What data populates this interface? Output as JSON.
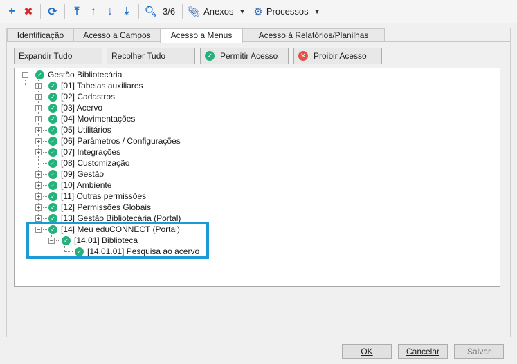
{
  "toolbar": {
    "record_position": "3/6",
    "attachments_label": "Anexos",
    "processes_label": "Processos"
  },
  "tabs": [
    {
      "label": "Identificação"
    },
    {
      "label": "Acesso a Campos"
    },
    {
      "label": "Acesso a Menus"
    },
    {
      "label": "Acesso à Relatórios/Planilhas"
    }
  ],
  "actions": {
    "expand": "Expandir Tudo",
    "collapse": "Recolher Tudo",
    "allow": "Permitir Acesso",
    "deny": "Proibir Acesso"
  },
  "tree": {
    "root": "Gestão Bibliotecária",
    "items": [
      {
        "label": "[01] Tabelas auxiliares"
      },
      {
        "label": "[02] Cadastros"
      },
      {
        "label": "[03] Acervo"
      },
      {
        "label": "[04] Movimentações"
      },
      {
        "label": "[05] Utilitários"
      },
      {
        "label": "[06] Parâmetros / Configurações"
      },
      {
        "label": "[07] Integrações"
      },
      {
        "label": "[08] Customização"
      },
      {
        "label": "[09] Gestão"
      },
      {
        "label": "[10] Ambiente"
      },
      {
        "label": "[11] Outras permissões"
      },
      {
        "label": "[12] Permissões Globais"
      },
      {
        "label": "[13] Gestão Bibliotecária (Portal)"
      },
      {
        "label": "[14] Meu eduCONNECT (Portal)"
      }
    ],
    "sub": {
      "label": "[14.01] Biblioteca"
    },
    "subsub": {
      "label": "[14.01.01] Pesquisa ao acervo"
    }
  },
  "buttons": {
    "ok": "OK",
    "cancel": "Cancelar",
    "save": "Salvar"
  },
  "colors": {
    "accent": "#1b9ad6",
    "check": "#23b37a",
    "deny": "#e2504a"
  }
}
